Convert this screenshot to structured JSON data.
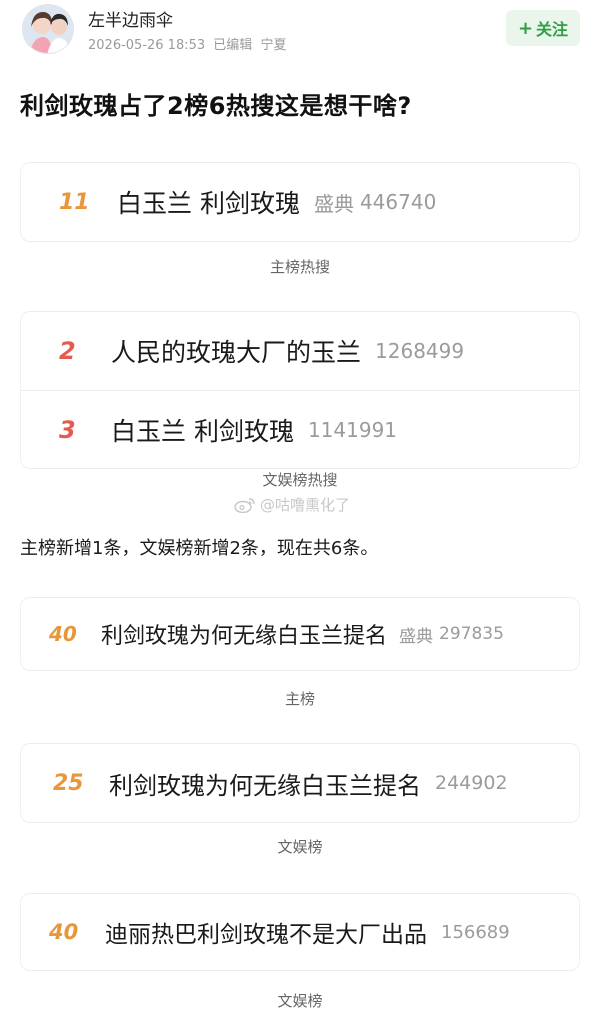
{
  "post": {
    "author": "左半边雨伞",
    "date": "2026-05-26 18:53",
    "edited": "已编辑",
    "location": "宁夏",
    "follow_label": "关注",
    "title": "利剑玫瑰占了2榜6热搜这是想干啥?"
  },
  "cards": [
    {
      "label": "主榜热搜",
      "items": [
        {
          "rank": "11",
          "title": "白玉兰 利剑玫瑰",
          "tag": "盛典",
          "count": "446740"
        }
      ]
    },
    {
      "label": "文娱榜热搜",
      "items": [
        {
          "rank": "2",
          "title": "人民的玫瑰大厂的玉兰",
          "tag": "",
          "count": "1268499"
        },
        {
          "rank": "3",
          "title": "白玉兰 利剑玫瑰",
          "tag": "",
          "count": "1141991"
        }
      ]
    },
    {
      "label": "主榜",
      "items": [
        {
          "rank": "40",
          "title": "利剑玫瑰为何无缘白玉兰提名",
          "tag": "盛典",
          "count": "297835"
        }
      ]
    },
    {
      "label": "文娱榜",
      "items": [
        {
          "rank": "25",
          "title": "利剑玫瑰为何无缘白玉兰提名",
          "tag": "",
          "count": "244902"
        }
      ]
    },
    {
      "label": "文娱榜",
      "items": [
        {
          "rank": "40",
          "title": "迪丽热巴利剑玫瑰不是大厂出品",
          "tag": "",
          "count": "156689"
        }
      ]
    }
  ],
  "summary": "主榜新增1条，文娱榜新增2条，现在共6条。",
  "watermark": "@咕噜熏化了",
  "colors": {
    "rank_orange": "#e8963a",
    "rank_red": "#e55a4e",
    "follow_green": "#2f9e44"
  }
}
